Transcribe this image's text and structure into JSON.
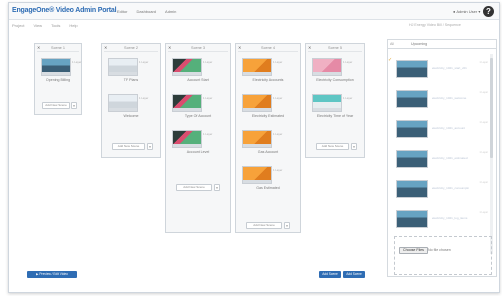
{
  "colors": {
    "brand": "#2f6db4",
    "accent_check": "#e2a32b"
  },
  "header": {
    "brand": "EngageOne® Video Admin Portal",
    "nav": [
      "Editor",
      "Dashboard",
      "Admin"
    ],
    "user": "Admin User",
    "help_icon": "?"
  },
  "menu": {
    "items": [
      "Project",
      "View",
      "Tools",
      "Help"
    ],
    "breadcrumb": "HJ Energy Video Bill / Sequence"
  },
  "scenes": [
    {
      "title": "Scene 1",
      "clips": [
        {
          "label": "Opening Billing",
          "tag": "1 Layer",
          "thumb": "blue"
        }
      ],
      "add_label": "Add New Scene"
    },
    {
      "title": "Scene 2",
      "clips": [
        {
          "label": "TF Plans",
          "tag": "1 Layer",
          "thumb": "blue"
        },
        {
          "label": "Welcome",
          "tag": "1 Layer",
          "thumb": "blue"
        }
      ],
      "add_label": "Add New Scene"
    },
    {
      "title": "Scene 3",
      "clips": [
        {
          "label": "Account Start",
          "tag": "1 Layer",
          "thumb": "green"
        },
        {
          "label": "Type Of Account",
          "tag": "1 Layer",
          "thumb": "green"
        },
        {
          "label": "Account Level",
          "tag": "1 Layer",
          "thumb": "green"
        }
      ],
      "add_label": "Add New Scene"
    },
    {
      "title": "Scene 4",
      "clips": [
        {
          "label": "Electricity Accounts",
          "tag": "1 Layer",
          "thumb": "orange"
        },
        {
          "label": "Electricity Estimated",
          "tag": "1 Layer",
          "thumb": "orange"
        },
        {
          "label": "Gas Account",
          "tag": "1 Layer",
          "thumb": "orange"
        },
        {
          "label": "Gas Estimated",
          "tag": "1 Layer",
          "thumb": "orange"
        }
      ],
      "add_label": "Add New Scene"
    },
    {
      "title": "Scene 5",
      "clips": [
        {
          "label": "Electricity Consumption",
          "tag": "1 Layer",
          "thumb": "pink"
        },
        {
          "label": "Electricity Time of Year",
          "tag": "1 Layer",
          "thumb": "teal"
        }
      ],
      "add_label": "Add New Scene"
    }
  ],
  "panel": {
    "tab1": "All",
    "tab2": "Upcoming",
    "items": [
      {
        "name": "electricity_1021_start_v01",
        "badge": "1 Layer"
      },
      {
        "name": "electricity_1021_welcome",
        "badge": "1 Layer"
      },
      {
        "name": "electricity_1021_account",
        "badge": "1 Layer"
      },
      {
        "name": "electricity_1021_estimated",
        "badge": "1 Layer"
      },
      {
        "name": "electricity_1021_consumptn",
        "badge": "1 Layer"
      },
      {
        "name": "electricity_1021_log_items",
        "badge": "1 Layer"
      }
    ],
    "choose_files": "Choose Files",
    "no_file": "No file chosen"
  },
  "bottom": {
    "left_btn": "▶ Preview / Edit Video",
    "btn_right_1": "Add Scene",
    "btn_right_2": "Add Scene"
  }
}
